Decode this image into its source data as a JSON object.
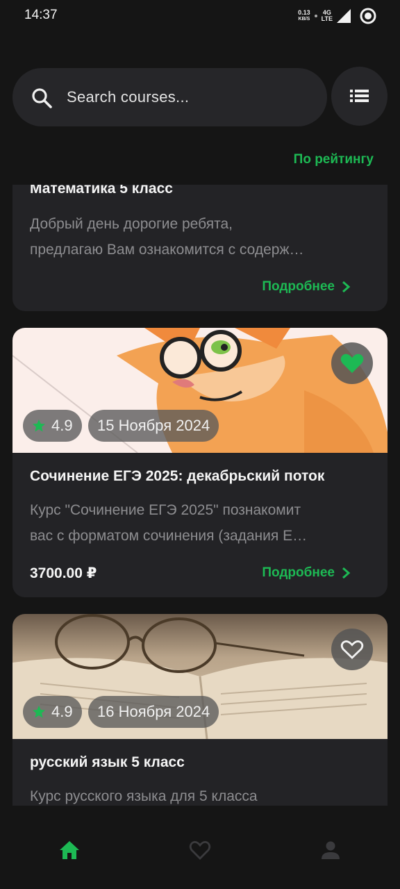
{
  "status_bar": {
    "time": "14:37",
    "net_speed_value": "0.13",
    "net_speed_unit": "KB/S",
    "net_type_top": "4G",
    "net_type_bottom": "LTE",
    "icons": [
      "signal-icon",
      "status-ring-icon"
    ]
  },
  "search": {
    "placeholder": "Search courses...",
    "value": "",
    "icon": "search-icon",
    "filter_icon": "list-icon"
  },
  "sort": {
    "label": "По рейтингу"
  },
  "courses": [
    {
      "title": "Математика 5 класс",
      "description_lines": [
        "Добрый день дорогие ребята,",
        "предлагаю Вам ознакомится с содерж…"
      ],
      "more_label": "Подробнее",
      "has_image": false
    },
    {
      "title": "Сочинение ЕГЭ 2025: декабрьский поток",
      "description_lines": [
        "Курс \"Сочинение ЕГЭ 2025\" познакомит",
        "вас с форматом сочинения (задания Е…"
      ],
      "price": "3700.00 ₽",
      "more_label": "Подробнее",
      "rating": "4.9",
      "date": "15 Ноября 2024",
      "favorite": true,
      "image": "cartoon-cat-with-glasses"
    },
    {
      "title": "русский язык 5 класс",
      "description_lines": [
        "Курс русского языка для 5 класса"
      ],
      "rating": "4.9",
      "date": "16 Ноября 2024",
      "favorite": false,
      "image": "glasses-on-open-book"
    }
  ],
  "bottom_nav": {
    "items": [
      {
        "icon": "home-icon",
        "active": true
      },
      {
        "icon": "heart-icon",
        "active": false
      },
      {
        "icon": "profile-icon",
        "active": false
      }
    ]
  },
  "colors": {
    "accent": "#1db954",
    "background": "#151515",
    "card": "#232326",
    "muted_text": "#8d8d90"
  }
}
